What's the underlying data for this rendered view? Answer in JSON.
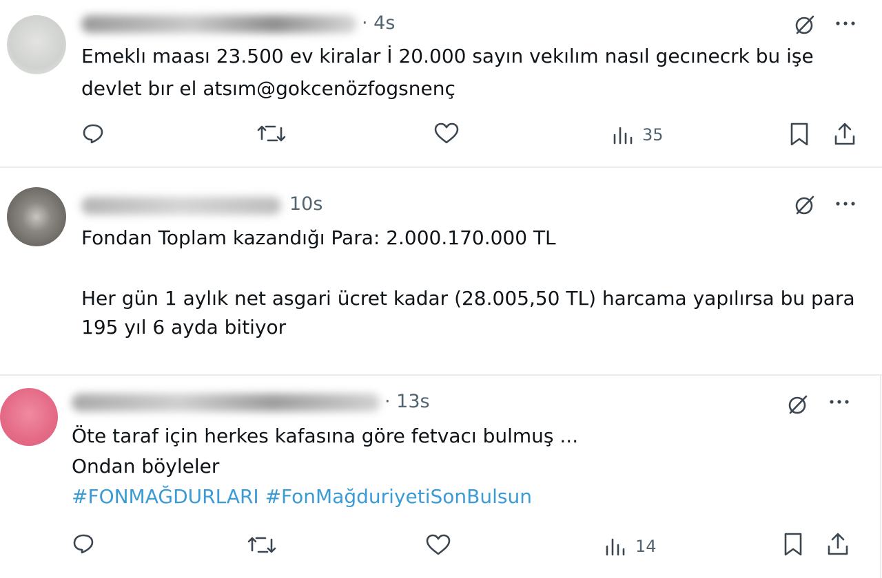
{
  "tweets": [
    {
      "time": "· 4s",
      "text_lines": [
        "Emeklı maası 23.500 ev kiralar İ 20.000 sayın vekılım nasıl gecınecrk bu işe",
        "devlet bır el atsım@gokcenözfogsnenç"
      ],
      "views": "35",
      "avatar_color": "#d9d9d6"
    },
    {
      "time": "10s",
      "text_lines": [
        "Fondan Toplam kazandığı Para: 2.000.170.000 TL",
        "",
        "Her gün 1 aylık net asgari ücret kadar (28.005,50 TL) harcama yapılırsa bu para",
        "195 yıl 6 ayda bitiyor"
      ],
      "avatar_color": "#6e6a66"
    },
    {
      "time": "· 13s",
      "text_lines": [
        "Öte taraf için herkes kafasına göre fetvacı bulmuş ...",
        "Ondan böyleler"
      ],
      "hashtags": [
        "#FONMAĞDURLARI",
        "#FonMağduriyetiSonBulsun"
      ],
      "views": "14",
      "avatar_color": "#e46a86"
    }
  ],
  "colors": {
    "text": "#0f1419",
    "secondary": "#536471",
    "hashtag": "#3a9bd6",
    "divider": "#e9ebee"
  },
  "icons": [
    "grok-icon",
    "more-icon",
    "reply-icon",
    "retweet-icon",
    "like-icon",
    "views-icon",
    "bookmark-icon",
    "share-icon"
  ]
}
